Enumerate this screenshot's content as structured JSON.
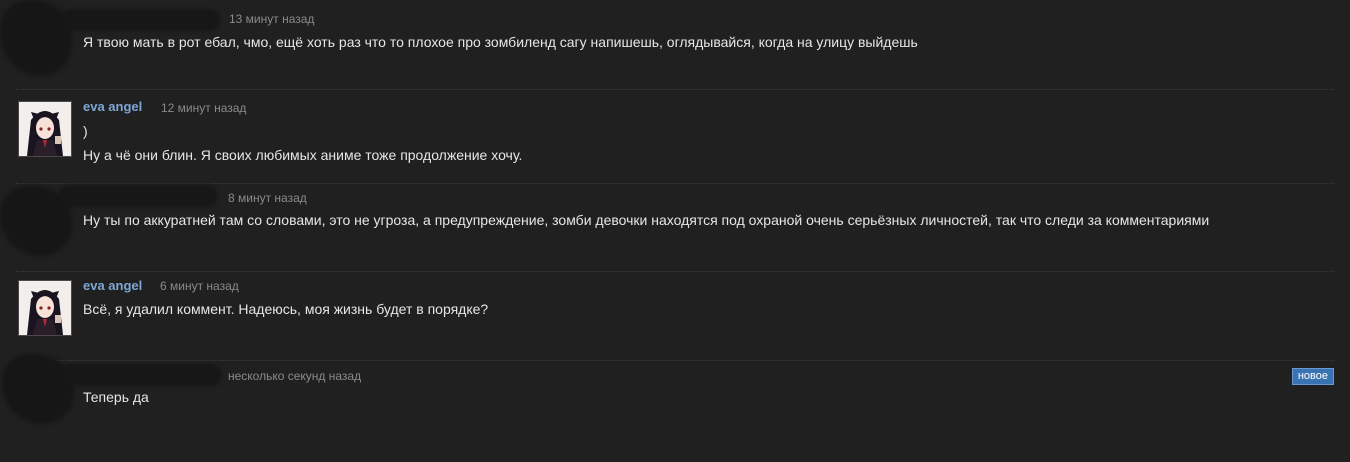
{
  "comments": [
    {
      "author": "",
      "time": "13 минут назад",
      "lines": [
        "Я твою мать в рот ебал, чмо, ещё хоть раз что то плохое про зомбиленд сагу напишешь, оглядывайся, когда на улицу выйдешь"
      ]
    },
    {
      "author": "eva angel",
      "time": "12 минут назад",
      "lines": [
        ")",
        "Ну а чё они блин. Я своих любимых аниме тоже продолжение хочу."
      ]
    },
    {
      "author": "",
      "time": "8 минут назад",
      "lines": [
        "Ну ты по аккуратней там со словами, это не угроза, а предупреждение, зомби девочки находятся под охраной очень серьёзных личностей, так что следи за комментариями"
      ]
    },
    {
      "author": "eva angel",
      "time": "6 минут назад",
      "lines": [
        "Всё, я удалил коммент. Надеюсь, моя жизнь будет в порядке?"
      ]
    },
    {
      "author": "",
      "time": "несколько секунд назад",
      "badge": "новое",
      "lines": [
        "Теперь да"
      ]
    }
  ],
  "colors": {
    "background": "#202020",
    "author_link": "#7ea6d6",
    "timestamp": "#8a8a8a",
    "text": "#e6e6e6",
    "new_badge": "#3a73b4"
  }
}
